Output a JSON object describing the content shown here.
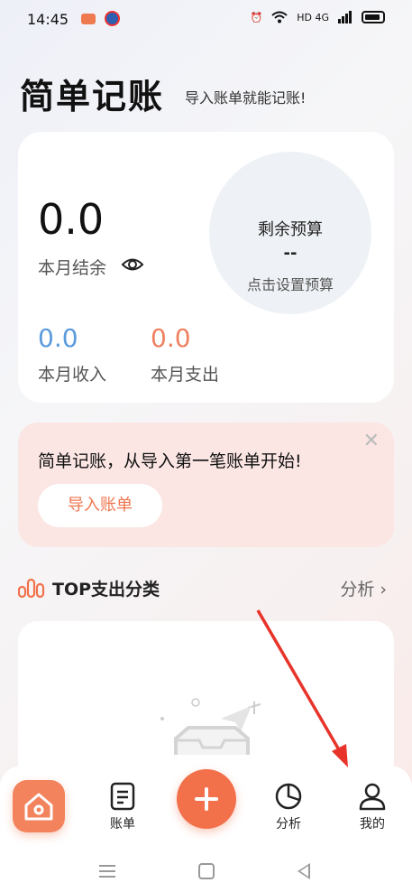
{
  "status_bar": {
    "time": "14:45",
    "network": "HD 4G"
  },
  "header": {
    "title": "简单记账",
    "subtitle": "导入账单就能记账!"
  },
  "summary": {
    "balance_value": "0.0",
    "balance_label": "本月结余",
    "budget_title": "剩余预算",
    "budget_value": "--",
    "budget_hint": "点击设置预算",
    "income_value": "0.0",
    "income_label": "本月收入",
    "expense_value": "0.0",
    "expense_label": "本月支出"
  },
  "import_banner": {
    "text": "简单记账，从导入第一笔账单开始!",
    "button_label": "导入账单",
    "close_symbol": "✕"
  },
  "top_expense": {
    "title": "TOP支出分类",
    "link_label": "分析 ›"
  },
  "bottom_nav": {
    "bill_label": "账单",
    "analysis_label": "分析",
    "mine_label": "我的"
  },
  "colors": {
    "accent": "#f2704a",
    "income": "#5b9bdc",
    "expense": "#ef8060",
    "banner_bg": "#fbe6e4",
    "annotation": "#e8332a"
  }
}
